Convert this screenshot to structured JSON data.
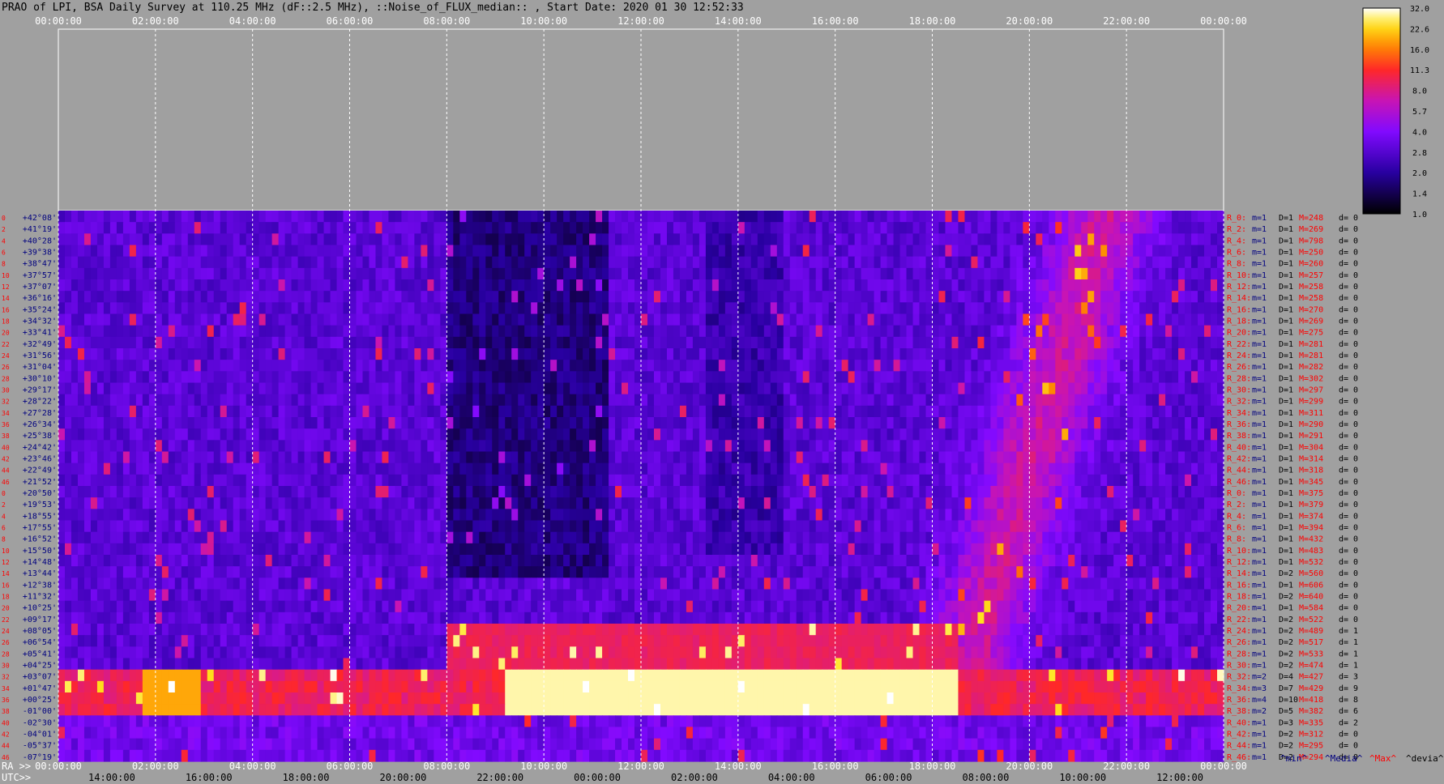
{
  "title": "PRAO of LPI, BSA Daily Survey at 110.25 MHz (dF::2.5 MHz), ::Noise_of_FLUX_median:: , Start Date: 2020 01 30 12:52:33",
  "chart_data": {
    "type": "heatmap",
    "title": "PRAO of LPI, BSA Daily Survey at 110.25 MHz (dF::2.5 MHz), ::Noise_of_FLUX_median:: , Start Date: 2020 01 30 12:52:33",
    "top_time_ticks": [
      "00:00:00",
      "02:00:00",
      "04:00:00",
      "06:00:00",
      "08:00:00",
      "10:00:00",
      "12:00:00",
      "14:00:00",
      "16:00:00",
      "18:00:00",
      "20:00:00",
      "22:00:00",
      "00:00:00"
    ],
    "ra_label": "RA >>",
    "ra_ticks": [
      "00:00:00",
      "02:00:00",
      "04:00:00",
      "06:00:00",
      "08:00:00",
      "10:00:00",
      "12:00:00",
      "14:00:00",
      "16:00:00",
      "18:00:00",
      "20:00:00",
      "22:00:00",
      "00:00:00"
    ],
    "utc_label": "UTC>>",
    "utc_ticks": [
      "14:00:00",
      "16:00:00",
      "18:00:00",
      "20:00:00",
      "22:00:00",
      "00:00:00",
      "02:00:00",
      "04:00:00",
      "06:00:00",
      "08:00:00",
      "10:00:00",
      "12:00:00"
    ],
    "declinations": [
      "+42°08'",
      "+41°19'",
      "+40°28'",
      "+39°38'",
      "+38°47'",
      "+37°57'",
      "+37°07'",
      "+36°16'",
      "+35°24'",
      "+34°32'",
      "+33°41'",
      "+32°49'",
      "+31°56'",
      "+31°04'",
      "+30°10'",
      "+29°17'",
      "+28°22'",
      "+27°28'",
      "+26°34'",
      "+25°38'",
      "+24°42'",
      "+23°46'",
      "+22°49'",
      "+21°52'",
      "+20°50'",
      "+19°53'",
      "+18°55'",
      "+17°55'",
      "+16°52'",
      "+15°50'",
      "+14°48'",
      "+13°44'",
      "+12°38'",
      "+11°32'",
      "+10°25'",
      "+09°17'",
      "+08°05'",
      "+06°54'",
      "+05°41'",
      "+04°25'",
      "+03°07'",
      "+01°47'",
      "+00°25'",
      "-01°00'",
      "-02°30'",
      "-04°01'",
      "-05°37'",
      "-07°19'"
    ],
    "colorbar_ticks": [
      "32.0",
      "22.6",
      "16.0",
      "11.3",
      "8.0",
      "5.7",
      "4.0",
      "2.8",
      "2.0",
      "1.4",
      "1.0"
    ],
    "colorbar_range": [
      1.0,
      32.0
    ],
    "colorbar_scale": "log",
    "colormap": "gnuplot2",
    "receivers": [
      [
        "R_0:",
        "m=1",
        "D=1",
        "M=248",
        "d= 0"
      ],
      [
        "R_2:",
        "m=1",
        "D=1",
        "M=269",
        "d= 0"
      ],
      [
        "R_4:",
        "m=1",
        "D=1",
        "M=798",
        "d= 0"
      ],
      [
        "R_6:",
        "m=1",
        "D=1",
        "M=250",
        "d= 0"
      ],
      [
        "R_8:",
        "m=1",
        "D=1",
        "M=260",
        "d= 0"
      ],
      [
        "R_10:",
        "m=1",
        "D=1",
        "M=257",
        "d= 0"
      ],
      [
        "R_12:",
        "m=1",
        "D=1",
        "M=258",
        "d= 0"
      ],
      [
        "R_14:",
        "m=1",
        "D=1",
        "M=258",
        "d= 0"
      ],
      [
        "R_16:",
        "m=1",
        "D=1",
        "M=270",
        "d= 0"
      ],
      [
        "R_18:",
        "m=1",
        "D=1",
        "M=269",
        "d= 0"
      ],
      [
        "R_20:",
        "m=1",
        "D=1",
        "M=275",
        "d= 0"
      ],
      [
        "R_22:",
        "m=1",
        "D=1",
        "M=281",
        "d= 0"
      ],
      [
        "R_24:",
        "m=1",
        "D=1",
        "M=281",
        "d= 0"
      ],
      [
        "R_26:",
        "m=1",
        "D=1",
        "M=282",
        "d= 0"
      ],
      [
        "R_28:",
        "m=1",
        "D=1",
        "M=302",
        "d= 0"
      ],
      [
        "R_30:",
        "m=1",
        "D=1",
        "M=297",
        "d= 0"
      ],
      [
        "R_32:",
        "m=1",
        "D=1",
        "M=299",
        "d= 0"
      ],
      [
        "R_34:",
        "m=1",
        "D=1",
        "M=311",
        "d= 0"
      ],
      [
        "R_36:",
        "m=1",
        "D=1",
        "M=290",
        "d= 0"
      ],
      [
        "R_38:",
        "m=1",
        "D=1",
        "M=291",
        "d= 0"
      ],
      [
        "R_40:",
        "m=1",
        "D=1",
        "M=304",
        "d= 0"
      ],
      [
        "R_42:",
        "m=1",
        "D=1",
        "M=314",
        "d= 0"
      ],
      [
        "R_44:",
        "m=1",
        "D=1",
        "M=318",
        "d= 0"
      ],
      [
        "R_46:",
        "m=1",
        "D=1",
        "M=345",
        "d= 0"
      ],
      [
        "R_0:",
        "m=1",
        "D=1",
        "M=375",
        "d= 0"
      ],
      [
        "R_2:",
        "m=1",
        "D=1",
        "M=379",
        "d= 0"
      ],
      [
        "R_4:",
        "m=1",
        "D=1",
        "M=374",
        "d= 0"
      ],
      [
        "R_6:",
        "m=1",
        "D=1",
        "M=394",
        "d= 0"
      ],
      [
        "R_8:",
        "m=1",
        "D=1",
        "M=432",
        "d= 0"
      ],
      [
        "R_10:",
        "m=1",
        "D=1",
        "M=483",
        "d= 0"
      ],
      [
        "R_12:",
        "m=1",
        "D=1",
        "M=532",
        "d= 0"
      ],
      [
        "R_14:",
        "m=1",
        "D=2",
        "M=560",
        "d= 0"
      ],
      [
        "R_16:",
        "m=1",
        "D=1",
        "M=606",
        "d= 0"
      ],
      [
        "R_18:",
        "m=1",
        "D=2",
        "M=640",
        "d= 0"
      ],
      [
        "R_20:",
        "m=1",
        "D=1",
        "M=584",
        "d= 0"
      ],
      [
        "R_22:",
        "m=1",
        "D=2",
        "M=522",
        "d= 0"
      ],
      [
        "R_24:",
        "m=1",
        "D=2",
        "M=489",
        "d= 1"
      ],
      [
        "R_26:",
        "m=1",
        "D=2",
        "M=517",
        "d= 1"
      ],
      [
        "R_28:",
        "m=1",
        "D=2",
        "M=533",
        "d= 1"
      ],
      [
        "R_30:",
        "m=1",
        "D=2",
        "M=474",
        "d= 1"
      ],
      [
        "R_32:",
        "m=2",
        "D=4",
        "M=427",
        "d= 3"
      ],
      [
        "R_34:",
        "m=3",
        "D=7",
        "M=429",
        "d= 9"
      ],
      [
        "R_36:",
        "m=4",
        "D=10",
        "M=418",
        "d= 8"
      ],
      [
        "R_38:",
        "m=2",
        "D=5",
        "M=382",
        "d= 6"
      ],
      [
        "R_40:",
        "m=1",
        "D=3",
        "M=335",
        "d= 2"
      ],
      [
        "R_42:",
        "m=1",
        "D=2",
        "M=312",
        "d= 0"
      ],
      [
        "R_44:",
        "m=1",
        "D=2",
        "M=295",
        "d= 0"
      ],
      [
        "R_46:",
        "m=1",
        "D=2",
        "M=294",
        "d= 0"
      ]
    ],
    "footer_legend": [
      "^min^",
      "^Media^",
      "^Max^",
      "^devia^"
    ],
    "row_numbers": [
      "0",
      "2",
      "4",
      "6",
      "8",
      "10",
      "12",
      "14",
      "16",
      "18",
      "20",
      "22",
      "24",
      "26",
      "28",
      "30",
      "32",
      "34",
      "36",
      "38",
      "40",
      "42",
      "44",
      "46",
      "0",
      "2",
      "4",
      "6",
      "8",
      "10",
      "12",
      "14",
      "16",
      "18",
      "20",
      "22",
      "24",
      "26",
      "28",
      "30",
      "32",
      "34",
      "36",
      "38",
      "40",
      "42",
      "44",
      "46"
    ]
  },
  "colors": {
    "background": "#a0a0a0",
    "label_blue": "#00007f",
    "label_red": "#ff0000",
    "grid": "#ffffff"
  }
}
